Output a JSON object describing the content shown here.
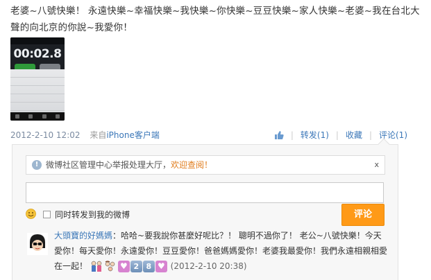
{
  "post": {
    "text": "老婆~八號快樂！ 永遠快樂~幸福快樂~我快樂~你快樂~豆豆快樂~家人快樂~老婆~我在台北大聲的向北京的你說~我愛你！"
  },
  "phone": {
    "timer": "00:02.8"
  },
  "meta": {
    "date": "2012-2-10 12:02",
    "source_prefix": "来自",
    "source_link": "iPhone客户端",
    "forward": "转发(1)",
    "favorite": "收藏",
    "comment": "评论(1)"
  },
  "comment_box": {
    "notice_text": "微博社区管理中心举报处理大厅，",
    "notice_link": "欢迎查阅！",
    "notice_close": "x",
    "input_value": "",
    "forward_label": "同时转发到我的微博",
    "submit_label": "评论"
  },
  "reply": {
    "user": "大頭寶的好媽媽",
    "text": "：哈哈~要我說你甚麼好呢比？！ 聰明不過你了！ 老公~八號快樂！今天愛你！每天愛你！永遠愛你！豆豆愛你！爸爸媽媽愛你！老婆我最愛你！我們永遠相親相愛在一起！",
    "digits": [
      "2",
      "8"
    ],
    "time": "(2012-2-10 20:38)"
  },
  "colors": {
    "link": "#3b77b8",
    "accent": "#ff9a17",
    "notice_link": "#e07c1c"
  }
}
